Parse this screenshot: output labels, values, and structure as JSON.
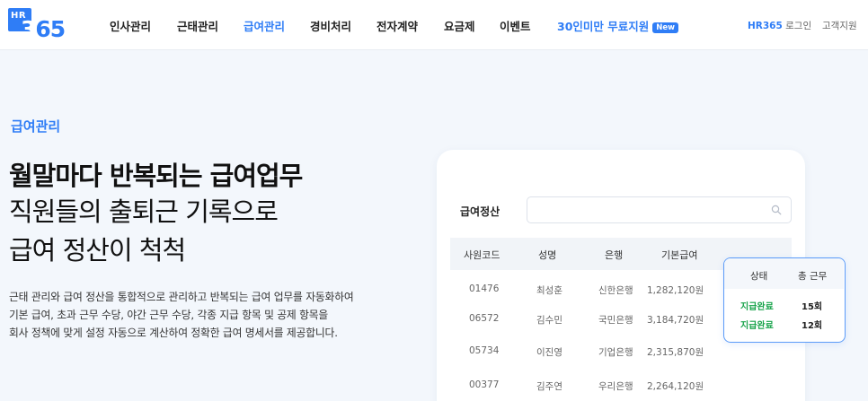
{
  "logo": {
    "top_text": "HR",
    "main_first": "3",
    "main_rest": "65"
  },
  "nav": {
    "items": [
      {
        "label": "인사관리",
        "active": false
      },
      {
        "label": "근태관리",
        "active": false
      },
      {
        "label": "급여관리",
        "active": true
      },
      {
        "label": "경비처리",
        "active": false
      },
      {
        "label": "전자계약",
        "active": false
      },
      {
        "label": "요금제",
        "active": false
      },
      {
        "label": "이벤트",
        "active": false
      }
    ],
    "promo": {
      "label": "30인미만 무료지원",
      "badge": "New"
    },
    "login": {
      "brand": "HR365",
      "label": " 로그인"
    },
    "support": "고객지원"
  },
  "hero": {
    "section_label": "급여관리",
    "headline": "월말마다 반복되는 급여업무",
    "subline_1": "직원들의 출퇴근 기록으로",
    "subline_2": "급여 정산이 척척",
    "desc_1": "근태 관리와 급여 정산을 통합적으로 관리하고 반복되는 급여 업무를 자동화하여",
    "desc_2": "기본 급여, 초과 근무 수당, 야간 근무 수당, 각종 지급 항목 및 공제 항목을",
    "desc_3": "회사 정책에 맞게 설정 자동으로 계산하여 정확한 급여 명세서를 제공합니다."
  },
  "card": {
    "title": "급여정산",
    "search_value": "",
    "columns": [
      "사원코드",
      "성명",
      "은행",
      "기본급여"
    ],
    "rows": [
      [
        "01476",
        "최성훈",
        "신한은행",
        "1,282,120원"
      ],
      [
        "06572",
        "김수민",
        "국민은행",
        "3,184,720원"
      ],
      [
        "05734",
        "이진영",
        "기업은행",
        "2,315,870원"
      ],
      [
        "00377",
        "김주연",
        "우리은행",
        "2,264,120원"
      ]
    ]
  },
  "status_popup": {
    "columns": [
      "상태",
      "총 근무"
    ],
    "rows": [
      [
        "지급완료",
        "15회"
      ],
      [
        "지급완료",
        "12회"
      ]
    ]
  },
  "colors": {
    "brand": "#2f7df6",
    "success": "#18a34a",
    "background": "#f3f7fc"
  }
}
